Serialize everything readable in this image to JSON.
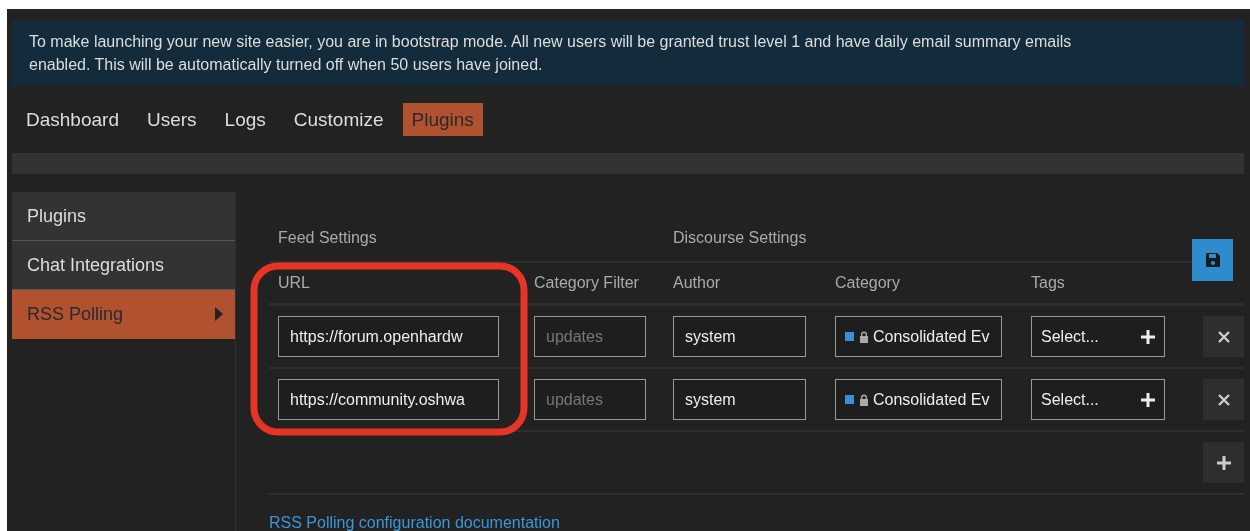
{
  "banner": {
    "text": "To make launching your new site easier, you are in bootstrap mode. All new users will be granted trust level 1 and have daily email summary emails enabled. This will be automatically turned off when 50 users have joined."
  },
  "nav_tabs": [
    {
      "label": "Dashboard",
      "selected": false
    },
    {
      "label": "Users",
      "selected": false
    },
    {
      "label": "Logs",
      "selected": false
    },
    {
      "label": "Customize",
      "selected": false
    },
    {
      "label": "Plugins",
      "selected": true
    }
  ],
  "sidebar": {
    "items": [
      {
        "label": "Plugins",
        "selected": false
      },
      {
        "label": "Chat Integrations",
        "selected": false
      },
      {
        "label": "RSS Polling",
        "selected": true
      }
    ]
  },
  "table": {
    "groups": [
      "Feed Settings",
      "Discourse Settings"
    ],
    "columns": [
      "URL",
      "Category Filter",
      "Author",
      "Category",
      "Tags"
    ],
    "rows": [
      {
        "url": "https://forum.openhardw",
        "category_filter_placeholder": "updates",
        "author": "system",
        "category": {
          "name": "Consolidated Ev",
          "color": "#3b8ed8",
          "locked": true
        },
        "tags_placeholder": "Select..."
      },
      {
        "url": "https://community.oshwa",
        "category_filter_placeholder": "updates",
        "author": "system",
        "category": {
          "name": "Consolidated Ev",
          "color": "#3b8ed8",
          "locked": true
        },
        "tags_placeholder": "Select..."
      }
    ]
  },
  "documentation_link": "RSS Polling configuration documentation"
}
